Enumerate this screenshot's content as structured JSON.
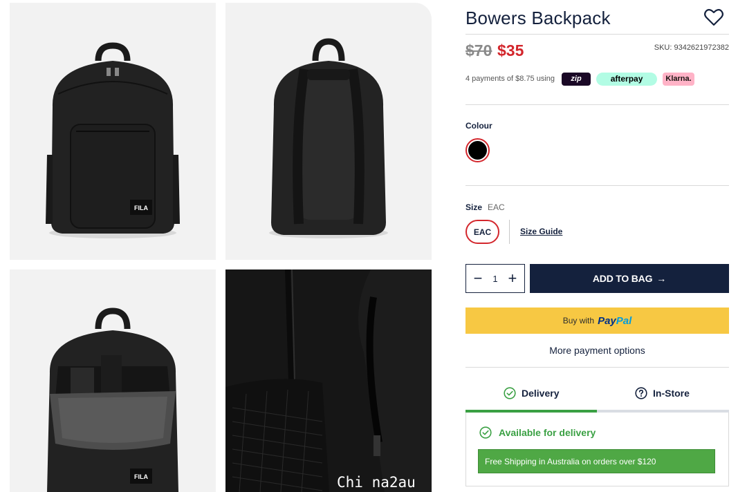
{
  "product": {
    "title": "Bowers Backpack",
    "price_was": "$70",
    "price_now": "$35",
    "sku": "SKU: 9342621972382"
  },
  "payments": {
    "installment_text": "4 payments of $8.75 using",
    "zip_label": "zip",
    "afterpay_label": "afterpay",
    "klarna_label": "Klarna."
  },
  "colour": {
    "label": "Colour",
    "selected": "black",
    "swatch_color": "#000000"
  },
  "size": {
    "label": "Size",
    "selected_value": "EAC",
    "option": "EAC",
    "guide_label": "Size Guide"
  },
  "quantity": {
    "value": "1",
    "minus": "−",
    "plus": "+"
  },
  "actions": {
    "add_to_bag": "ADD TO BAG",
    "add_arrow": "→",
    "paypal_prefix": "Buy with",
    "paypal_brand_1": "Pay",
    "paypal_brand_2": "Pal",
    "more_payment": "More payment options"
  },
  "tabs": [
    {
      "label": "Delivery",
      "icon": "check-circle-icon",
      "active": true
    },
    {
      "label": "In-Store",
      "icon": "question-circle-icon",
      "active": false
    }
  ],
  "delivery": {
    "status": "Available for delivery",
    "shipping_note": "Free Shipping in Australia on orders over $120"
  },
  "gallery": {
    "brand_patch": "FILA",
    "watermark": "Chi na2au"
  },
  "colors": {
    "navy": "#14213d",
    "sale_red": "#d3262c",
    "success_green": "#3aa043",
    "paypal_yellow": "#f7c843",
    "tab_active": "#3aa043",
    "tab_inactive": "#d9dde3"
  }
}
